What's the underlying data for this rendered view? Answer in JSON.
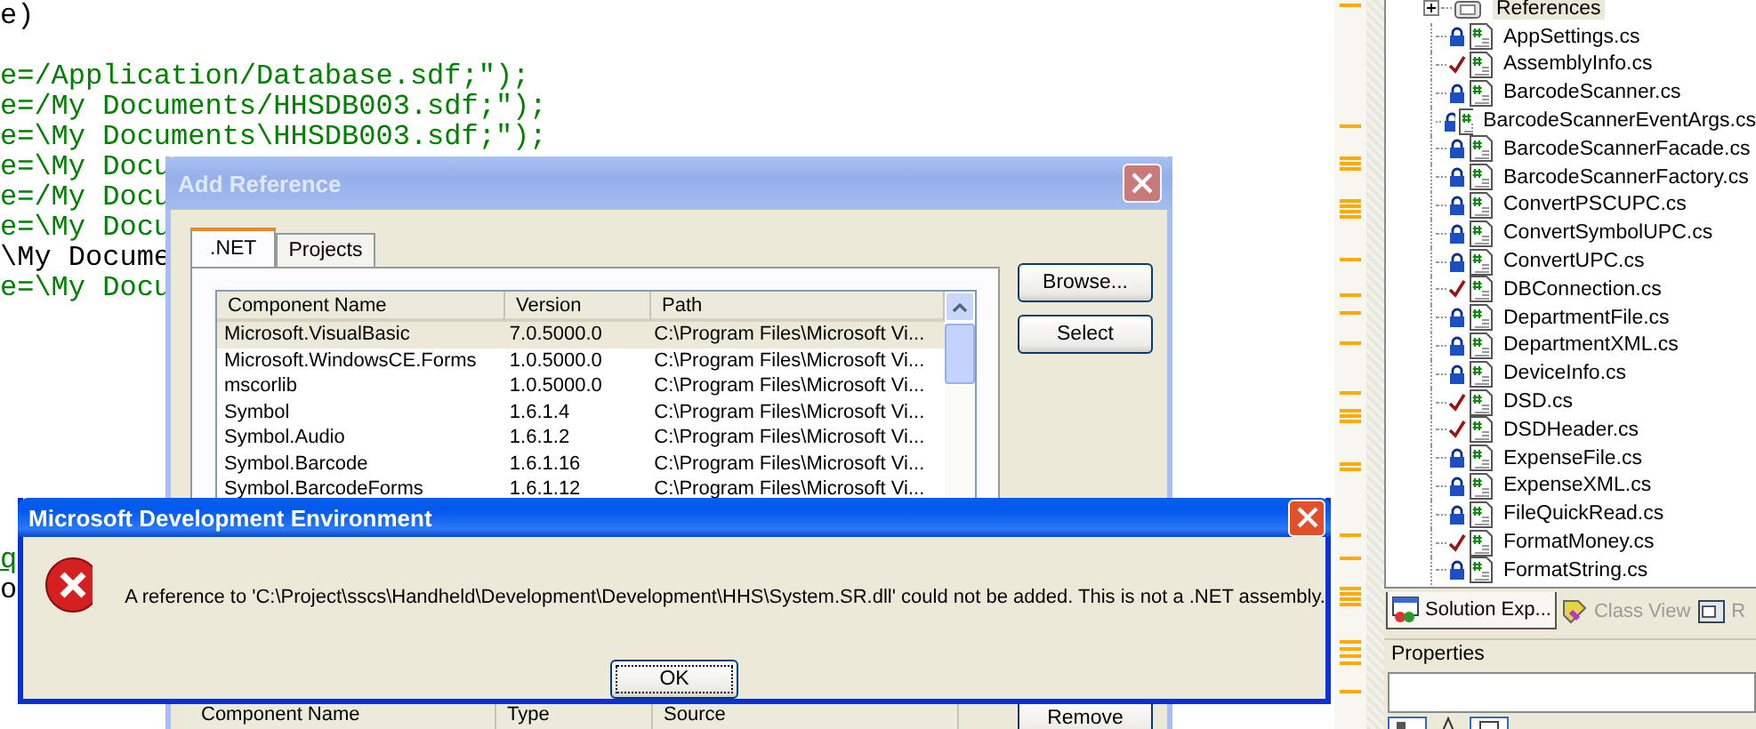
{
  "editor": {
    "lines": [
      {
        "kind": "plain",
        "text": "e)"
      },
      {
        "kind": "blank"
      },
      {
        "kind": "string",
        "text": "e=/Application/Database.sdf;\");"
      },
      {
        "kind": "string",
        "text": "e=/My Documents/HHSDB003.sdf;\");"
      },
      {
        "kind": "string",
        "text": "e=\\My Documents\\HHSDB003.sdf;\");"
      },
      {
        "kind": "string",
        "text": "e=\\My Docu"
      },
      {
        "kind": "string",
        "text": "e=/My Docu"
      },
      {
        "kind": "string",
        "text": "e=\\My Docu"
      },
      {
        "kind": "plain",
        "text": "\\My Docume"
      },
      {
        "kind": "string",
        "text": "e=\\My Docu"
      },
      {
        "kind": "blank"
      },
      {
        "kind": "blank"
      },
      {
        "kind": "blank"
      },
      {
        "kind": "blank"
      },
      {
        "kind": "blank"
      },
      {
        "kind": "blank"
      },
      {
        "kind": "blank"
      },
      {
        "kind": "blank"
      },
      {
        "kind": "link",
        "text": "q"
      },
      {
        "kind": "plain",
        "text": "o"
      }
    ]
  },
  "add_reference": {
    "title": "Add Reference",
    "tabs": [
      {
        "label": ".NET",
        "selected": true
      },
      {
        "label": "Projects",
        "selected": false
      }
    ],
    "columns": [
      "Component Name",
      "Version",
      "Path"
    ],
    "rows": [
      {
        "cells": [
          "Microsoft.VisualBasic",
          "7.0.5000.0",
          "C:\\Program Files\\Microsoft Vi..."
        ],
        "selected": true
      },
      {
        "cells": [
          "Microsoft.WindowsCE.Forms",
          "1.0.5000.0",
          "C:\\Program Files\\Microsoft Vi..."
        ],
        "selected": false
      },
      {
        "cells": [
          "mscorlib",
          "1.0.5000.0",
          "C:\\Program Files\\Microsoft Vi..."
        ],
        "selected": false
      },
      {
        "cells": [
          "Symbol",
          "1.6.1.4",
          "C:\\Program Files\\Microsoft Vi..."
        ],
        "selected": false
      },
      {
        "cells": [
          "Symbol.Audio",
          "1.6.1.2",
          "C:\\Program Files\\Microsoft Vi..."
        ],
        "selected": false
      },
      {
        "cells": [
          "Symbol.Barcode",
          "1.6.1.16",
          "C:\\Program Files\\Microsoft Vi..."
        ],
        "selected": false
      },
      {
        "cells": [
          "Symbol.BarcodeForms",
          "1.6.1.12",
          "C:\\Program Files\\Microsoft Vi..."
        ],
        "selected": false
      }
    ],
    "buttons": [
      "Browse...",
      "Select"
    ],
    "selected_columns": [
      "Component Name",
      "Type",
      "Source"
    ],
    "remove_button": "Remove"
  },
  "error_dialog": {
    "title": "Microsoft Development Environment",
    "message": "A reference to 'C:\\Project\\sscs\\Handheld\\Development\\Development\\HHS\\System.SR.dll' could not be added. This is not a .NET assembly.",
    "button": "OK"
  },
  "solution_explorer": {
    "items": [
      {
        "kind": "references",
        "label": "References",
        "expanded": false,
        "selected": true
      },
      {
        "kind": "locked",
        "label": "AppSettings.cs",
        "selected": false
      },
      {
        "kind": "checked",
        "label": "AssemblyInfo.cs",
        "selected": false
      },
      {
        "kind": "locked",
        "label": "BarcodeScanner.cs",
        "selected": false
      },
      {
        "kind": "locked",
        "label": "BarcodeScannerEventArgs.cs",
        "selected": false
      },
      {
        "kind": "locked",
        "label": "BarcodeScannerFacade.cs",
        "selected": false
      },
      {
        "kind": "locked",
        "label": "BarcodeScannerFactory.cs",
        "selected": false
      },
      {
        "kind": "locked",
        "label": "ConvertPSCUPC.cs",
        "selected": false
      },
      {
        "kind": "locked",
        "label": "ConvertSymbolUPC.cs",
        "selected": false
      },
      {
        "kind": "locked",
        "label": "ConvertUPC.cs",
        "selected": false
      },
      {
        "kind": "checked",
        "label": "DBConnection.cs",
        "selected": false
      },
      {
        "kind": "locked",
        "label": "DepartmentFile.cs",
        "selected": false
      },
      {
        "kind": "locked",
        "label": "DepartmentXML.cs",
        "selected": false
      },
      {
        "kind": "locked",
        "label": "DeviceInfo.cs",
        "selected": false
      },
      {
        "kind": "checked",
        "label": "DSD.cs",
        "selected": false
      },
      {
        "kind": "checked",
        "label": "DSDHeader.cs",
        "selected": false
      },
      {
        "kind": "locked",
        "label": "ExpenseFile.cs",
        "selected": false
      },
      {
        "kind": "locked",
        "label": "ExpenseXML.cs",
        "selected": false
      },
      {
        "kind": "locked",
        "label": "FileQuickRead.cs",
        "selected": false
      },
      {
        "kind": "checked",
        "label": "FormatMoney.cs",
        "selected": false
      },
      {
        "kind": "locked",
        "label": "FormatString.cs",
        "selected": false
      }
    ],
    "tabs": [
      {
        "label": "Solution Exp...",
        "selected": true,
        "kind": "solution"
      },
      {
        "label": "Class View",
        "selected": false,
        "kind": "class"
      },
      {
        "label": "R",
        "selected": false,
        "kind": "resource"
      }
    ]
  },
  "properties": {
    "title": "Properties"
  }
}
